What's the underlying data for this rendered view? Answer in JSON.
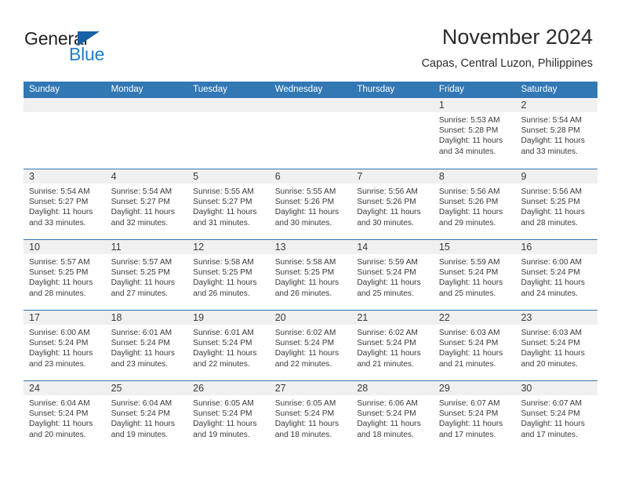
{
  "logo": {
    "word_one": "General",
    "word_two": "Blue",
    "triangle_icon": "triangle-icon"
  },
  "header": {
    "title": "November 2024",
    "subtitle": "Capas, Central Luzon, Philippines"
  },
  "colors": {
    "header_blue": "#3178b5",
    "row_divider_blue": "#2f77b4",
    "day_band_gray": "#f0f0f0",
    "logo_blue": "#1f7fd0",
    "logo_triangle": "#1761a6",
    "text": "#3a3a3a"
  },
  "weekdays": [
    "Sunday",
    "Monday",
    "Tuesday",
    "Wednesday",
    "Thursday",
    "Friday",
    "Saturday"
  ],
  "labels": {
    "sunrise_prefix": "Sunrise:",
    "sunset_prefix": "Sunset:",
    "daylight_prefix": "Daylight:"
  },
  "weeks": [
    [
      {
        "day": "",
        "empty": true
      },
      {
        "day": "",
        "empty": true
      },
      {
        "day": "",
        "empty": true
      },
      {
        "day": "",
        "empty": true
      },
      {
        "day": "",
        "empty": true
      },
      {
        "day": "1",
        "sunrise": "Sunrise: 5:53 AM",
        "sunset": "Sunset: 5:28 PM",
        "daylight": "Daylight: 11 hours and 34 minutes."
      },
      {
        "day": "2",
        "sunrise": "Sunrise: 5:54 AM",
        "sunset": "Sunset: 5:28 PM",
        "daylight": "Daylight: 11 hours and 33 minutes."
      }
    ],
    [
      {
        "day": "3",
        "sunrise": "Sunrise: 5:54 AM",
        "sunset": "Sunset: 5:27 PM",
        "daylight": "Daylight: 11 hours and 33 minutes."
      },
      {
        "day": "4",
        "sunrise": "Sunrise: 5:54 AM",
        "sunset": "Sunset: 5:27 PM",
        "daylight": "Daylight: 11 hours and 32 minutes."
      },
      {
        "day": "5",
        "sunrise": "Sunrise: 5:55 AM",
        "sunset": "Sunset: 5:27 PM",
        "daylight": "Daylight: 11 hours and 31 minutes."
      },
      {
        "day": "6",
        "sunrise": "Sunrise: 5:55 AM",
        "sunset": "Sunset: 5:26 PM",
        "daylight": "Daylight: 11 hours and 30 minutes."
      },
      {
        "day": "7",
        "sunrise": "Sunrise: 5:56 AM",
        "sunset": "Sunset: 5:26 PM",
        "daylight": "Daylight: 11 hours and 30 minutes."
      },
      {
        "day": "8",
        "sunrise": "Sunrise: 5:56 AM",
        "sunset": "Sunset: 5:26 PM",
        "daylight": "Daylight: 11 hours and 29 minutes."
      },
      {
        "day": "9",
        "sunrise": "Sunrise: 5:56 AM",
        "sunset": "Sunset: 5:25 PM",
        "daylight": "Daylight: 11 hours and 28 minutes."
      }
    ],
    [
      {
        "day": "10",
        "sunrise": "Sunrise: 5:57 AM",
        "sunset": "Sunset: 5:25 PM",
        "daylight": "Daylight: 11 hours and 28 minutes."
      },
      {
        "day": "11",
        "sunrise": "Sunrise: 5:57 AM",
        "sunset": "Sunset: 5:25 PM",
        "daylight": "Daylight: 11 hours and 27 minutes."
      },
      {
        "day": "12",
        "sunrise": "Sunrise: 5:58 AM",
        "sunset": "Sunset: 5:25 PM",
        "daylight": "Daylight: 11 hours and 26 minutes."
      },
      {
        "day": "13",
        "sunrise": "Sunrise: 5:58 AM",
        "sunset": "Sunset: 5:25 PM",
        "daylight": "Daylight: 11 hours and 26 minutes."
      },
      {
        "day": "14",
        "sunrise": "Sunrise: 5:59 AM",
        "sunset": "Sunset: 5:24 PM",
        "daylight": "Daylight: 11 hours and 25 minutes."
      },
      {
        "day": "15",
        "sunrise": "Sunrise: 5:59 AM",
        "sunset": "Sunset: 5:24 PM",
        "daylight": "Daylight: 11 hours and 25 minutes."
      },
      {
        "day": "16",
        "sunrise": "Sunrise: 6:00 AM",
        "sunset": "Sunset: 5:24 PM",
        "daylight": "Daylight: 11 hours and 24 minutes."
      }
    ],
    [
      {
        "day": "17",
        "sunrise": "Sunrise: 6:00 AM",
        "sunset": "Sunset: 5:24 PM",
        "daylight": "Daylight: 11 hours and 23 minutes."
      },
      {
        "day": "18",
        "sunrise": "Sunrise: 6:01 AM",
        "sunset": "Sunset: 5:24 PM",
        "daylight": "Daylight: 11 hours and 23 minutes."
      },
      {
        "day": "19",
        "sunrise": "Sunrise: 6:01 AM",
        "sunset": "Sunset: 5:24 PM",
        "daylight": "Daylight: 11 hours and 22 minutes."
      },
      {
        "day": "20",
        "sunrise": "Sunrise: 6:02 AM",
        "sunset": "Sunset: 5:24 PM",
        "daylight": "Daylight: 11 hours and 22 minutes."
      },
      {
        "day": "21",
        "sunrise": "Sunrise: 6:02 AM",
        "sunset": "Sunset: 5:24 PM",
        "daylight": "Daylight: 11 hours and 21 minutes."
      },
      {
        "day": "22",
        "sunrise": "Sunrise: 6:03 AM",
        "sunset": "Sunset: 5:24 PM",
        "daylight": "Daylight: 11 hours and 21 minutes."
      },
      {
        "day": "23",
        "sunrise": "Sunrise: 6:03 AM",
        "sunset": "Sunset: 5:24 PM",
        "daylight": "Daylight: 11 hours and 20 minutes."
      }
    ],
    [
      {
        "day": "24",
        "sunrise": "Sunrise: 6:04 AM",
        "sunset": "Sunset: 5:24 PM",
        "daylight": "Daylight: 11 hours and 20 minutes."
      },
      {
        "day": "25",
        "sunrise": "Sunrise: 6:04 AM",
        "sunset": "Sunset: 5:24 PM",
        "daylight": "Daylight: 11 hours and 19 minutes."
      },
      {
        "day": "26",
        "sunrise": "Sunrise: 6:05 AM",
        "sunset": "Sunset: 5:24 PM",
        "daylight": "Daylight: 11 hours and 19 minutes."
      },
      {
        "day": "27",
        "sunrise": "Sunrise: 6:05 AM",
        "sunset": "Sunset: 5:24 PM",
        "daylight": "Daylight: 11 hours and 18 minutes."
      },
      {
        "day": "28",
        "sunrise": "Sunrise: 6:06 AM",
        "sunset": "Sunset: 5:24 PM",
        "daylight": "Daylight: 11 hours and 18 minutes."
      },
      {
        "day": "29",
        "sunrise": "Sunrise: 6:07 AM",
        "sunset": "Sunset: 5:24 PM",
        "daylight": "Daylight: 11 hours and 17 minutes."
      },
      {
        "day": "30",
        "sunrise": "Sunrise: 6:07 AM",
        "sunset": "Sunset: 5:24 PM",
        "daylight": "Daylight: 11 hours and 17 minutes."
      }
    ]
  ]
}
